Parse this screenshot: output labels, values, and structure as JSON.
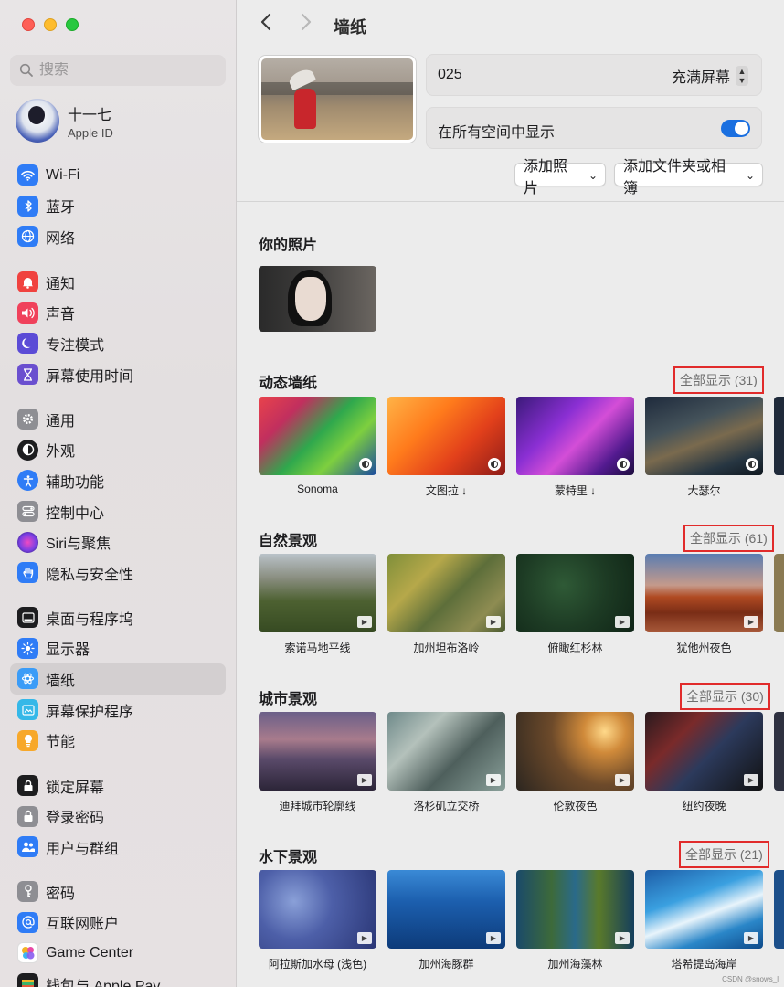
{
  "window": {
    "title": "墙纸"
  },
  "search": {
    "placeholder": "搜索"
  },
  "profile": {
    "name": "十一七",
    "subtitle": "Apple ID"
  },
  "sidebar": {
    "items": [
      {
        "label": "Wi-Fi",
        "icon": "wifi-icon",
        "color": "#2f7cf6"
      },
      {
        "label": "蓝牙",
        "icon": "bluetooth-icon",
        "color": "#2f7cf6"
      },
      {
        "label": "网络",
        "icon": "globe-icon",
        "color": "#2f7cf6"
      },
      {
        "label": "通知",
        "icon": "bell-icon",
        "color": "#f0423f"
      },
      {
        "label": "声音",
        "icon": "speaker-icon",
        "color": "#f0415b"
      },
      {
        "label": "专注模式",
        "icon": "moon-icon",
        "color": "#5b4bd6"
      },
      {
        "label": "屏幕使用时间",
        "icon": "hourglass-icon",
        "color": "#6a4fcf"
      },
      {
        "label": "通用",
        "icon": "gear-icon",
        "color": "#8e8e93"
      },
      {
        "label": "外观",
        "icon": "appearance-icon",
        "color": "#1d1d1f"
      },
      {
        "label": "辅助功能",
        "icon": "accessibility-icon",
        "color": "#2f7cf6"
      },
      {
        "label": "控制中心",
        "icon": "control-center-icon",
        "color": "#8e8e93"
      },
      {
        "label": "Siri与聚焦",
        "icon": "siri-icon",
        "color": "#7b3fe4"
      },
      {
        "label": "隐私与安全性",
        "icon": "hand-icon",
        "color": "#2f7cf6"
      },
      {
        "label": "桌面与程序坞",
        "icon": "dock-icon",
        "color": "#1d1d1f"
      },
      {
        "label": "显示器",
        "icon": "sun-icon",
        "color": "#2f7cf6"
      },
      {
        "label": "墙纸",
        "icon": "wallpaper-icon",
        "color": "#3b9cf7"
      },
      {
        "label": "屏幕保护程序",
        "icon": "screensaver-icon",
        "color": "#35b8e8"
      },
      {
        "label": "节能",
        "icon": "lightbulb-icon",
        "color": "#f7a82a"
      },
      {
        "label": "锁定屏幕",
        "icon": "lock-screen-icon",
        "color": "#1d1d1f"
      },
      {
        "label": "登录密码",
        "icon": "lock-icon",
        "color": "#8e8e93"
      },
      {
        "label": "用户与群组",
        "icon": "users-icon",
        "color": "#2f7cf6"
      },
      {
        "label": "密码",
        "icon": "key-icon",
        "color": "#8e8e93"
      },
      {
        "label": "互联网账户",
        "icon": "at-icon",
        "color": "#2f7cf6"
      },
      {
        "label": "Game Center",
        "icon": "game-center-icon",
        "color": "#e94aa6"
      },
      {
        "label": "钱包与 Apple Pay",
        "icon": "wallet-icon",
        "color": "#1d1d1f"
      }
    ],
    "selected": "墙纸"
  },
  "wallpaper": {
    "current_name": "025",
    "fill_mode": "充满屏幕",
    "all_spaces_label": "在所有空间中显示",
    "all_spaces_on": true,
    "add_photo_label": "添加照片",
    "add_folder_label": "添加文件夹或相簿"
  },
  "sections": {
    "your_photos": {
      "title": "你的照片"
    },
    "dynamic": {
      "title": "动态墙纸",
      "show_all": "全部显示 (31)",
      "items": [
        "Sonoma",
        "文图拉 ↓",
        "蒙特里 ↓",
        "大瑟尔"
      ]
    },
    "nature": {
      "title": "自然景观",
      "show_all": "全部显示 (61)",
      "items": [
        "索诺马地平线",
        "加州坦布洛岭",
        "俯瞰红杉林",
        "犹他州夜色"
      ]
    },
    "city": {
      "title": "城市景观",
      "show_all": "全部显示 (30)",
      "items": [
        "迪拜城市轮廓线",
        "洛杉矶立交桥",
        "伦敦夜色",
        "纽约夜晚"
      ]
    },
    "underwater": {
      "title": "水下景观",
      "show_all": "全部显示 (21)",
      "items": [
        "阿拉斯加水母 (浅色)",
        "加州海豚群",
        "加州海藻林",
        "塔希提岛海岸"
      ]
    }
  },
  "watermark": "CSDN @snows_l"
}
